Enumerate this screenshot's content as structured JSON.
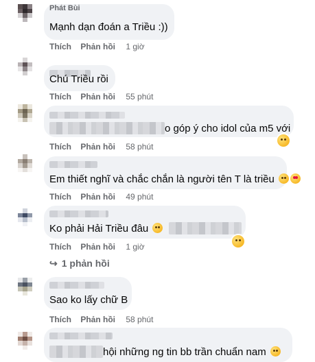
{
  "comments": [
    {
      "name": "Phát Bùi",
      "text": "Mạnh dạn đoán a Triều :))",
      "actions": {
        "like": "Thích",
        "reply": "Phản hồi",
        "time": "1 giờ"
      }
    },
    {
      "name": "",
      "text": "Chú Triều rồi",
      "actions": {
        "like": "Thích",
        "reply": "Phản hồi",
        "time": "55 phút"
      }
    },
    {
      "name": "",
      "text_suffix": "o góp ý cho idol của m5 với",
      "reaction_icon": "laughing-emoji-icon",
      "actions": {
        "like": "Thích",
        "reply": "Phản hồi",
        "time": "58 phút"
      }
    },
    {
      "name": "",
      "text": "Em thiết nghĩ và chắc chắn là người tên T là triều",
      "emojis": [
        "grinning-emoji-icon",
        "heart-eyes-emoji-icon"
      ],
      "actions": {
        "like": "Thích",
        "reply": "Phản hồi",
        "time": "49 phút"
      }
    },
    {
      "name": "",
      "text_prefix": "Ko phải Hải Triều đâu",
      "reaction_icon": "sad-emoji-icon",
      "actions": {
        "like": "Thích",
        "reply": "Phản hồi",
        "time": "1 giờ"
      },
      "replies_label": "1 phản hồi"
    },
    {
      "name": "",
      "text": "Sao ko lấy chữ B",
      "actions": {
        "like": "Thích",
        "reply": "Phản hồi",
        "time": "58 phút"
      }
    },
    {
      "name": "",
      "text_suffix": "hội những ng tin bb trần chuẩn nam",
      "emojis": [
        "pleading-emoji-icon"
      ]
    }
  ],
  "colors": {
    "bubble": "#f0f2f5",
    "text": "#050505",
    "meta": "#65676b"
  }
}
